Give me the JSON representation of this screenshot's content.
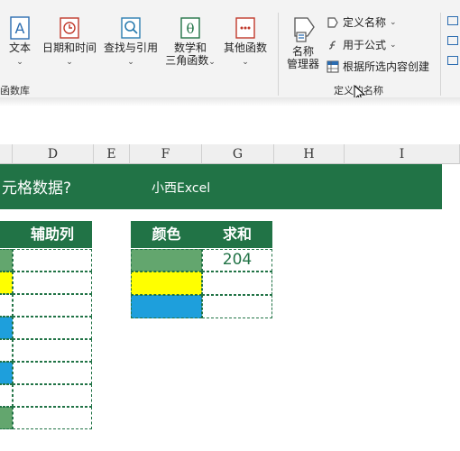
{
  "ribbon": {
    "buttons": [
      {
        "name": "text-button",
        "label": "文本",
        "label2": "",
        "icon": "A",
        "icon_color": "#2b6cb0"
      },
      {
        "name": "datetime-button",
        "label": "日期和时间",
        "label2": "",
        "icon": "clock",
        "icon_color": "#c0392b"
      },
      {
        "name": "lookup-button",
        "label": "查找与引用",
        "label2": "",
        "icon": "magnify",
        "icon_color": "#2b7db0"
      },
      {
        "name": "math-button",
        "label": "数学和",
        "label2": "三角函数",
        "icon": "θ",
        "icon_color": "#217346"
      },
      {
        "name": "other-functions-button",
        "label": "其他函数",
        "label2": "",
        "icon": "dots",
        "icon_color": "#c0392b"
      }
    ],
    "library_group_label": "函数库",
    "name_manager_label1": "名称",
    "name_manager_label2": "管理器",
    "define_name": "定义名称",
    "use_in_formula": "用于公式",
    "create_from_selection": "根据所选内容创建",
    "defined_names_group_label": "定义的名称"
  },
  "columns": [
    "D",
    "E",
    "F",
    "G",
    "H",
    "I"
  ],
  "title_text": "元格数据?",
  "title_brand": "小西Excel",
  "table_left": {
    "header": "辅助列"
  },
  "table_right": {
    "headers": [
      "颜色",
      "求和"
    ],
    "sum_value": "204",
    "swatches": [
      "#63a66e",
      "#ffff00",
      "#1e9fdc"
    ]
  },
  "left_swatches": [
    "#63a66e",
    "#ffff00",
    "#ffffff",
    "#1e9fdc",
    "#ffffff",
    "#1e9fdc",
    "#ffffff",
    "#63a66e"
  ]
}
